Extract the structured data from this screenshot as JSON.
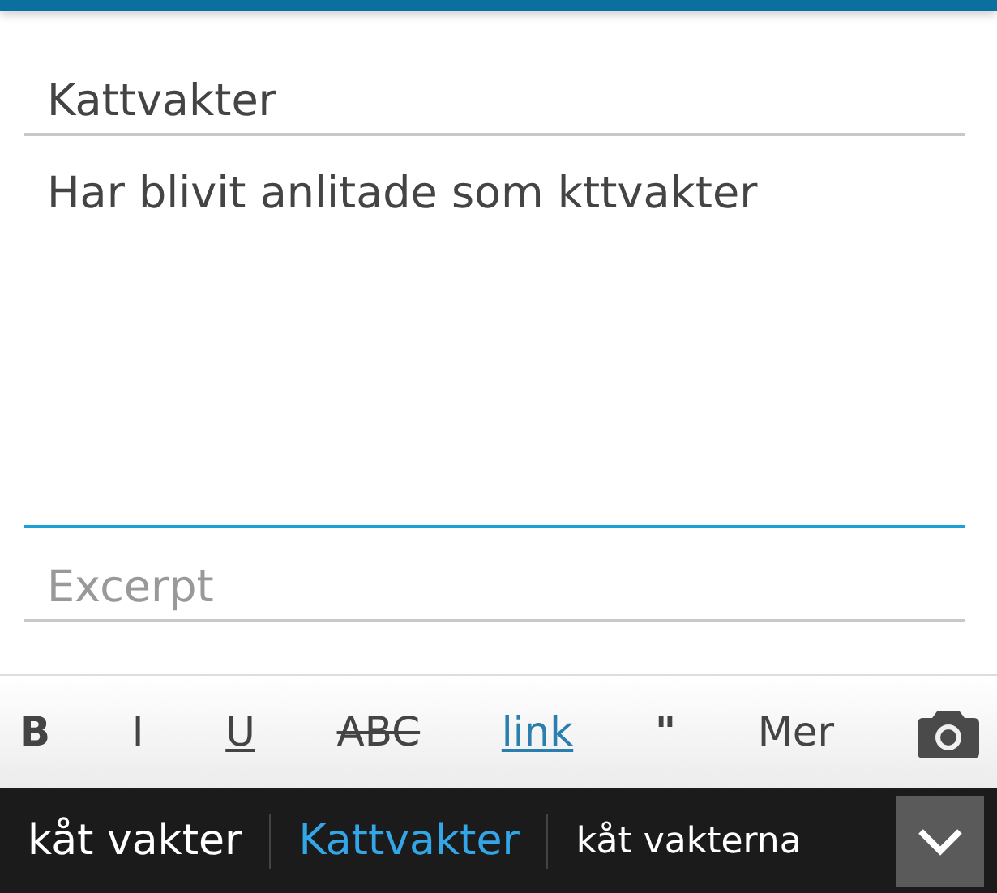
{
  "fields": [
    {
      "kind": "input",
      "value": "Kattvakter",
      "focused": false
    },
    {
      "kind": "textarea",
      "value": "Har blivit anlitade som kttvakter",
      "focused": true
    },
    {
      "kind": "input",
      "placeholder": "Excerpt",
      "focused": false
    }
  ],
  "toolbar": [
    {
      "kind": "bold",
      "label": "B"
    },
    {
      "kind": "italic",
      "label": "I"
    },
    {
      "kind": "underline",
      "label": "U"
    },
    {
      "kind": "strike",
      "label": "ABC"
    },
    {
      "kind": "link",
      "label": "link"
    },
    {
      "kind": "quote",
      "label": "\""
    },
    {
      "kind": "text",
      "label": "Mer"
    },
    {
      "kind": "camera"
    }
  ],
  "suggestions": [
    {
      "label": "kåt vakter",
      "selected": false
    },
    {
      "label": "Kattvakter",
      "selected": true
    },
    {
      "label": "kåt vakterna",
      "selected": false
    }
  ]
}
